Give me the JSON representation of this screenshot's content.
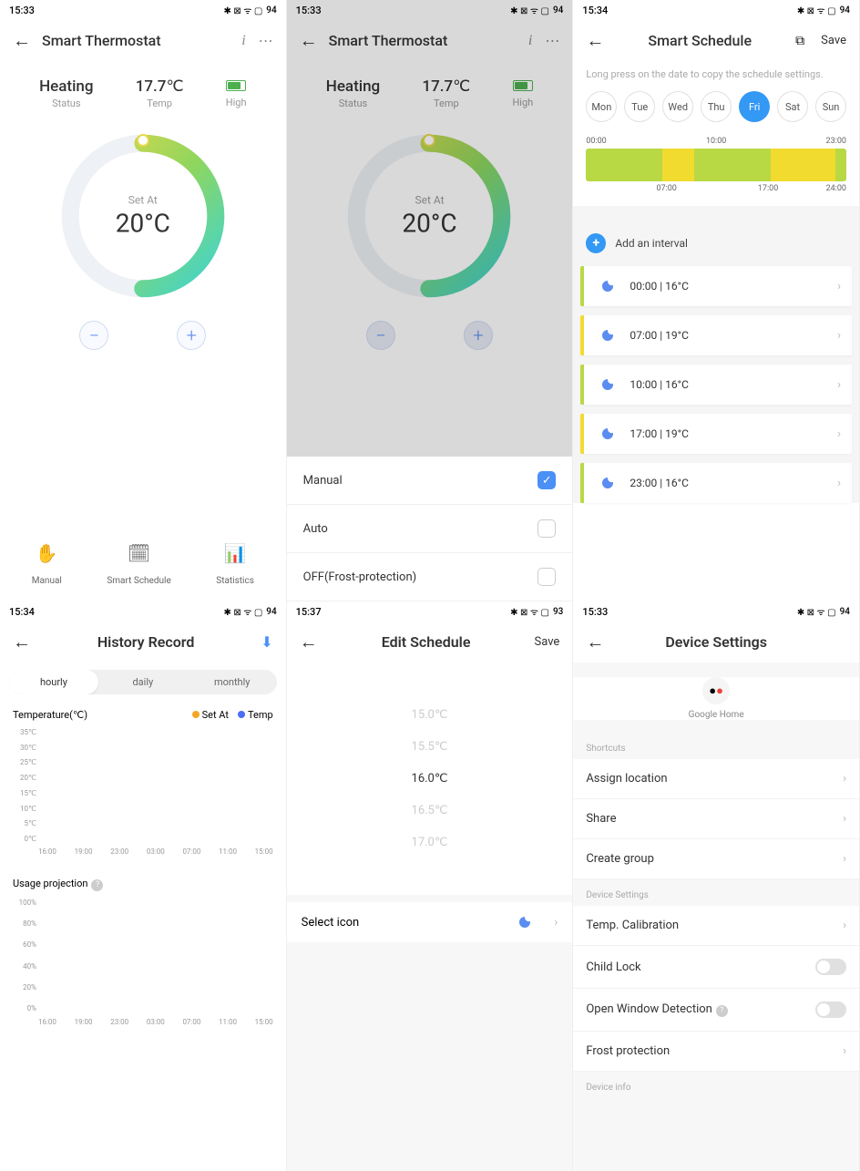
{
  "status_bars": {
    "s1": {
      "time": "15:33",
      "battery": "94"
    },
    "s2": {
      "time": "15:33",
      "battery": "94"
    },
    "s3": {
      "time": "15:34",
      "battery": "94"
    },
    "s4": {
      "time": "15:34",
      "battery": "94"
    },
    "s5": {
      "time": "15:37",
      "battery": "93"
    },
    "s6": {
      "time": "15:33",
      "battery": "94"
    }
  },
  "screen1": {
    "title": "Smart Thermostat",
    "status_val": "Heating",
    "status_label": "Status",
    "temp_val": "17.7℃",
    "temp_label": "Temp",
    "batt_label": "High",
    "set_at": "Set At",
    "set_val": "20°C",
    "nav": {
      "manual": "Manual",
      "schedule": "Smart Schedule",
      "stats": "Statistics"
    }
  },
  "screen2": {
    "title": "Smart Thermostat",
    "modes": {
      "manual": "Manual",
      "auto": "Auto",
      "off": "OFF(Frost-protection)"
    }
  },
  "screen3": {
    "title": "Smart Schedule",
    "save": "Save",
    "hint": "Long press on the date to copy the schedule settings.",
    "days": [
      "Mon",
      "Tue",
      "Wed",
      "Thu",
      "Fri",
      "Sat",
      "Sun"
    ],
    "active_day_index": 4,
    "timeline_top": [
      "00:00",
      "10:00",
      "23:00"
    ],
    "timeline_bottom": {
      "l1": "07:00",
      "l2": "17:00",
      "l3": "24:00"
    },
    "add": "Add an interval",
    "intervals": [
      {
        "text": "00:00 | 16°C",
        "color": "#b8d943"
      },
      {
        "text": "07:00 | 19°C",
        "color": "#f2db2f"
      },
      {
        "text": "10:00 | 16°C",
        "color": "#b8d943"
      },
      {
        "text": "17:00 | 19°C",
        "color": "#f2db2f"
      },
      {
        "text": "23:00 | 16°C",
        "color": "#b8d943"
      }
    ]
  },
  "screen4": {
    "title": "History Record",
    "tabs": {
      "hourly": "hourly",
      "daily": "daily",
      "monthly": "monthly"
    },
    "chart1_title": "Temperature(℃)",
    "legend": {
      "setat": "Set At",
      "temp": "Temp"
    },
    "chart2_title": "Usage projection"
  },
  "chart_data": [
    {
      "type": "line",
      "title": "Temperature(℃)",
      "series": [
        {
          "name": "Set At",
          "values": []
        },
        {
          "name": "Temp",
          "values": []
        }
      ],
      "x": [
        "16:00",
        "19:00",
        "23:00",
        "03:00",
        "07:00",
        "11:00",
        "15:00"
      ],
      "y_ticks": [
        "0℃",
        "5℃",
        "10℃",
        "15℃",
        "20℃",
        "25℃",
        "30℃",
        "35℃"
      ],
      "ylim": [
        0,
        35
      ]
    },
    {
      "type": "bar",
      "title": "Usage projection",
      "categories": [
        "16:00",
        "19:00",
        "23:00",
        "03:00",
        "07:00",
        "11:00",
        "15:00"
      ],
      "values": [],
      "y_ticks": [
        "0%",
        "20%",
        "40%",
        "60%",
        "80%",
        "100%"
      ],
      "ylim": [
        0,
        100
      ]
    }
  ],
  "screen5": {
    "title": "Edit Schedule",
    "save": "Save",
    "picker": [
      "15.0℃",
      "15.5℃",
      "16.0℃",
      "16.5℃",
      "17.0℃"
    ],
    "selected_index": 2,
    "select_icon": "Select icon"
  },
  "screen6": {
    "title": "Device Settings",
    "google": "Google Home",
    "shortcuts_head": "Shortcuts",
    "shortcuts": [
      "Assign location",
      "Share",
      "Create group"
    ],
    "settings_head": "Device Settings",
    "settings": {
      "calib": "Temp. Calibration",
      "childlock": "Child Lock",
      "window": "Open Window Detection",
      "frost": "Frost protection"
    },
    "info_head": "Device info"
  }
}
